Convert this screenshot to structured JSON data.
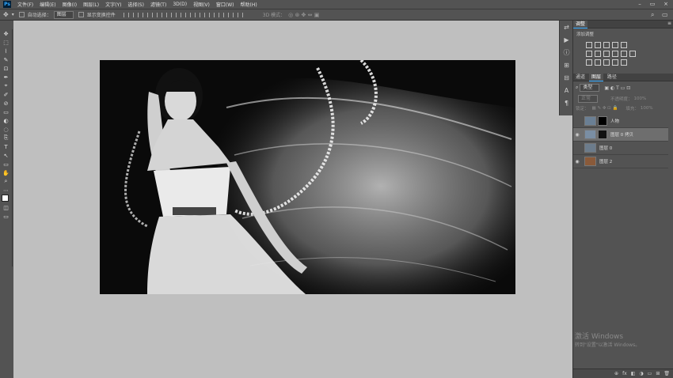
{
  "menu": [
    "文件(F)",
    "编辑(E)",
    "图像(I)",
    "图层(L)",
    "文字(Y)",
    "选择(S)",
    "滤镜(T)",
    "3D(D)",
    "视图(V)",
    "窗口(W)",
    "帮助(H)"
  ],
  "app_logo": "Ps",
  "options": {
    "auto_select": "自动选择：",
    "auto_select_value": "图层",
    "show_transform": "显示变换控件",
    "mode_3d": "3D 模式："
  },
  "tools": [
    "✥",
    "⬚",
    "⌇",
    "✎",
    "⊡",
    "✒",
    "⌖",
    "✐",
    "⊘",
    "▭",
    "◐",
    "◌",
    "⎘",
    "T",
    "↖",
    "▭",
    "✋",
    "⌕",
    "⋯"
  ],
  "right_strip": [
    "⇄",
    "▶",
    "ⓘ",
    "⊞",
    "⊟",
    "A",
    "¶"
  ],
  "panels": {
    "adjust_tab": "调整",
    "add_adjust": "添加调整",
    "tabs": [
      "通道",
      "图层",
      "路径"
    ],
    "filter_label": "类型",
    "blend_mode": "正常",
    "opacity_label": "不透明度：",
    "opacity_value": "100%",
    "lock_label": "锁定：",
    "fill_label": "填充：",
    "fill_value": "100%",
    "layers": [
      {
        "name": "人物",
        "selected": false
      },
      {
        "name": "图层 0 拷贝",
        "selected": true
      },
      {
        "name": "图层 0",
        "selected": false
      },
      {
        "name": "图层 2",
        "selected": false
      }
    ],
    "footer_icons": [
      "⊕",
      "fx",
      "◧",
      "◑",
      "▭",
      "⊞",
      "🗑"
    ]
  },
  "watermark": {
    "line1": "激活 Windows",
    "line2": "转到\"设置\"以激活 Windows。"
  },
  "colors": {
    "accent": "#31a8ff",
    "canvas_bg": "#bfbfbf",
    "panel_bg": "#535353"
  }
}
